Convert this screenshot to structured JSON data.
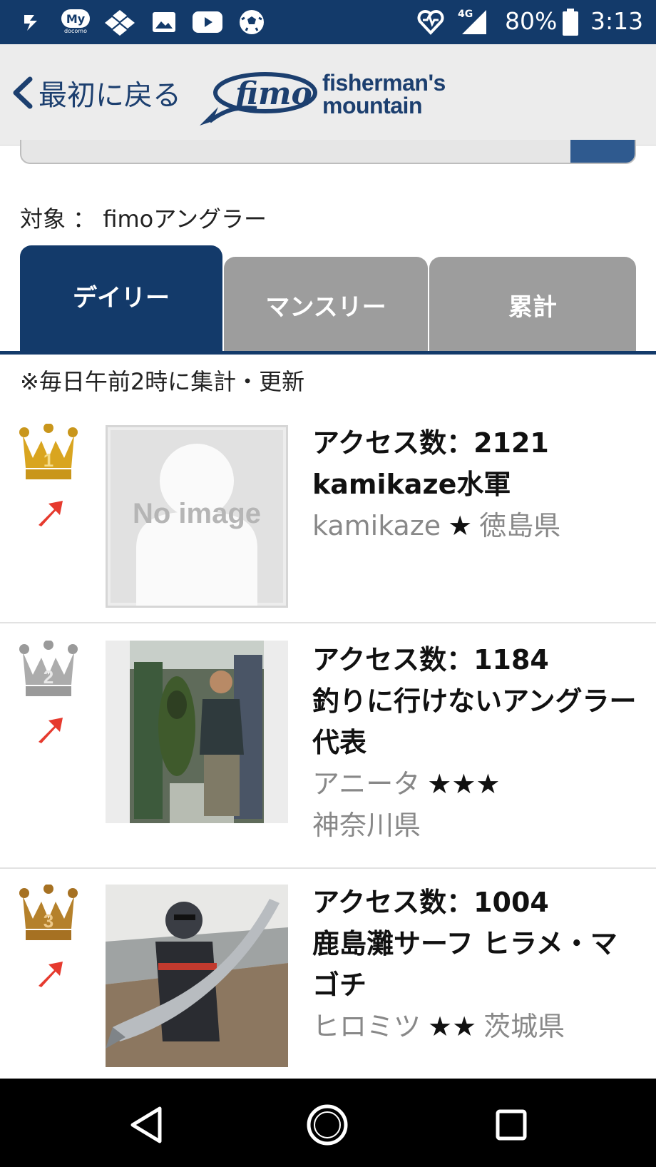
{
  "status_bar": {
    "battery": "80%",
    "time": "3:13",
    "network": "4G",
    "docomo_badge": "My",
    "docomo_sub": "docomo",
    "icons": [
      "download-icon",
      "docomo-my-icon",
      "app-grid-icon",
      "gallery-icon",
      "youtube-icon",
      "soccer-ball-icon",
      "health-icon",
      "signal-icon",
      "battery-icon"
    ]
  },
  "header": {
    "back_label": "最初に戻る",
    "logo_word": "fimo",
    "logo_line1": "fisherman's",
    "logo_line2": "mountain",
    "accent_color": "#1c3f6f"
  },
  "target_label": "対象 ： fimoアングラー",
  "tabs": [
    {
      "label": "デイリー",
      "active": true
    },
    {
      "label": "マンスリー",
      "active": false
    },
    {
      "label": "累計",
      "active": false
    }
  ],
  "note": "※毎日午前2時に集計・更新",
  "ranking": [
    {
      "rank": "1",
      "rank_color": "gold",
      "trend": "up",
      "thumb_text": "No image",
      "access": "アクセス数：2121",
      "title": "kamikaze水軍",
      "user": "kamikaze",
      "stars": "★",
      "prefecture": "徳島県"
    },
    {
      "rank": "2",
      "rank_color": "silver",
      "trend": "up",
      "access": "アクセス数：1184",
      "title": "釣りに行けないアングラー代表",
      "user": "アニータ",
      "stars": "★★★",
      "prefecture": "神奈川県"
    },
    {
      "rank": "3",
      "rank_color": "bronze",
      "trend": "up",
      "access": "アクセス数：1004",
      "title": "鹿島灘サーフ ヒラメ・マゴチ",
      "user": "ヒロミツ",
      "stars": "★★",
      "prefecture": "茨城県"
    }
  ],
  "nav": [
    "back-triangle-icon",
    "home-circle-icon",
    "recents-square-icon"
  ]
}
